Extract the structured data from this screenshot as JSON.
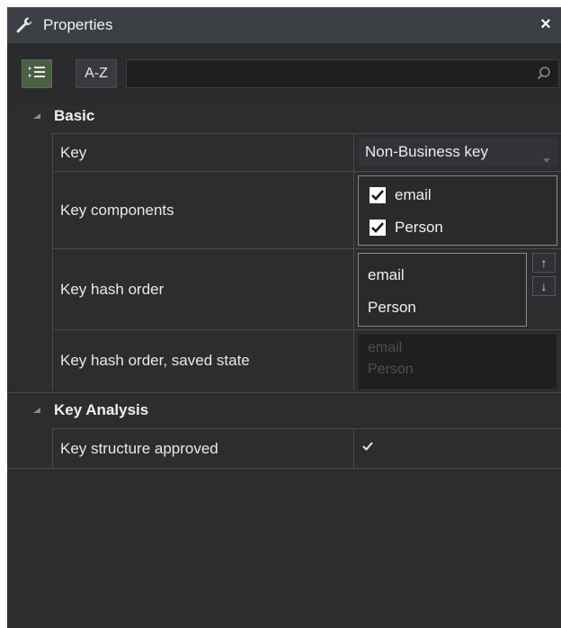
{
  "window": {
    "title": "Properties",
    "close_label": "×"
  },
  "toolbar": {
    "categorized_icon": "categorized-list-icon",
    "az_label": "A-Z",
    "search_value": "",
    "search_icon": "search-icon"
  },
  "sections": {
    "basic": {
      "label": "Basic",
      "expanded": true
    },
    "key_analysis": {
      "label": "Key Analysis",
      "expanded": true
    }
  },
  "properties": {
    "key": {
      "name": "Key",
      "value": "Non-Business key"
    },
    "key_components": {
      "name": "Key components",
      "items": [
        {
          "label": "email",
          "checked": true
        },
        {
          "label": "Person",
          "checked": true
        }
      ]
    },
    "key_hash_order": {
      "name": "Key hash order",
      "items": [
        "email",
        "Person"
      ],
      "up_label": "↑",
      "down_label": "↓"
    },
    "key_hash_order_saved": {
      "name": "Key hash order, saved state",
      "items": [
        "email",
        "Person"
      ]
    },
    "key_structure_approved": {
      "name": "Key structure approved",
      "checked": true
    }
  },
  "colors": {
    "panel_bg": "#2d2d30",
    "titlebar_bg": "#3c3f44",
    "active_button": "#4b5f45",
    "grid_line": "#4a4a4d"
  }
}
